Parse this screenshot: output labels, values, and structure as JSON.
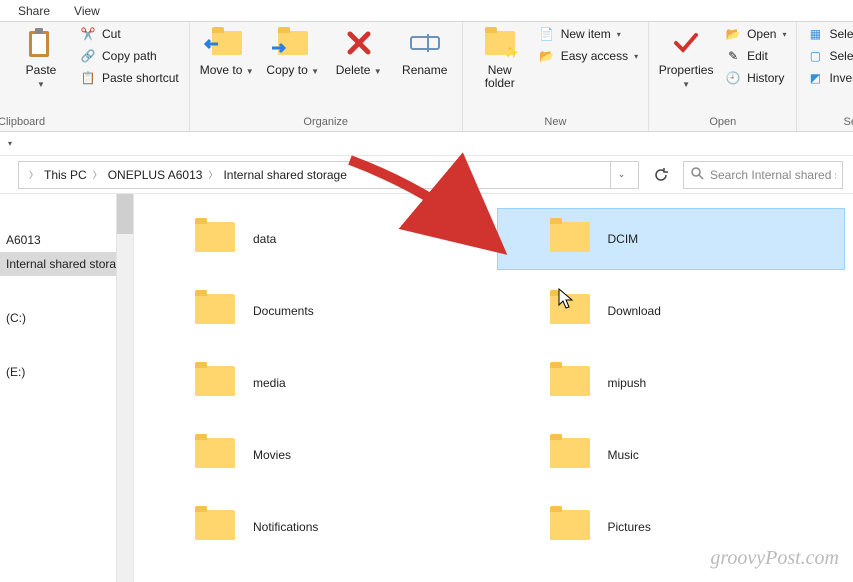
{
  "tabs": {
    "share": "Share",
    "view": "View"
  },
  "ribbon": {
    "clipboard": {
      "title": "Clipboard",
      "paste": "Paste",
      "cut": "Cut",
      "copy_path": "Copy path",
      "paste_shortcut": "Paste shortcut"
    },
    "organize": {
      "title": "Organize",
      "move_to": "Move to",
      "copy_to": "Copy to",
      "delete": "Delete",
      "rename": "Rename"
    },
    "new": {
      "title": "New",
      "new_folder": "New folder",
      "new_item": "New item",
      "easy_access": "Easy access"
    },
    "open": {
      "title": "Open",
      "properties": "Properties",
      "open": "Open",
      "edit": "Edit",
      "history": "History"
    },
    "select": {
      "title": "Select",
      "select_all": "Select all",
      "select_none": "Select none",
      "invert": "Invert selection"
    }
  },
  "breadcrumb": {
    "pc": "This PC",
    "device": "ONEPLUS A6013",
    "location": "Internal shared storage"
  },
  "search": {
    "placeholder": "Search Internal shared storage"
  },
  "nav": {
    "device": "A6013",
    "storage": "Internal shared storage",
    "drive_c": "(C:)",
    "drive_e": "(E:)"
  },
  "folders": [
    {
      "name": "data"
    },
    {
      "name": "DCIM",
      "selected": true
    },
    {
      "name": "Documents"
    },
    {
      "name": "Download"
    },
    {
      "name": "media"
    },
    {
      "name": "mipush"
    },
    {
      "name": "Movies"
    },
    {
      "name": "Music"
    },
    {
      "name": "Notifications"
    },
    {
      "name": "Pictures"
    }
  ],
  "watermark": "groovyPost.com"
}
